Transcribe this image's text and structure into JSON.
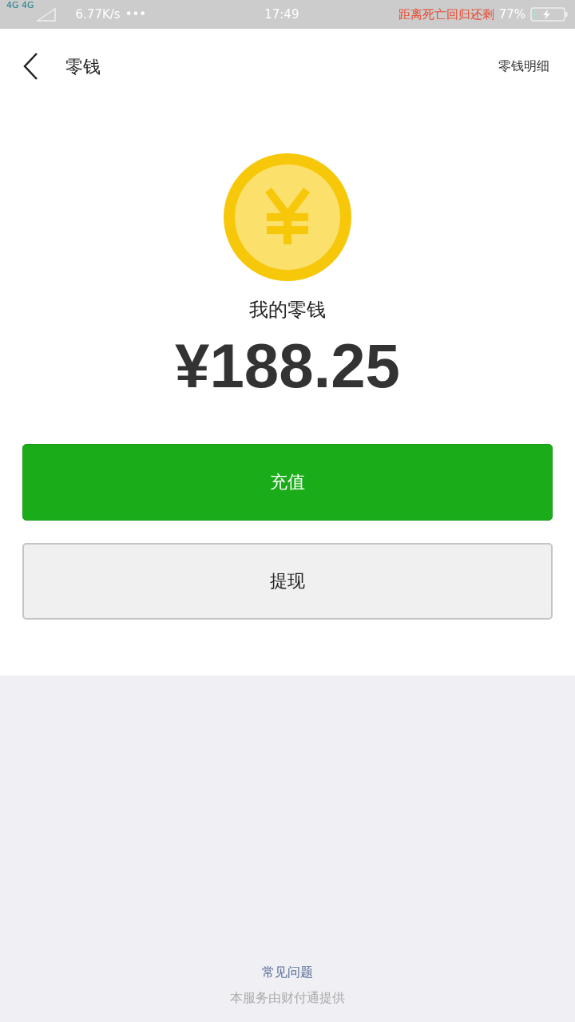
{
  "status_bar": {
    "network": "4G 4G",
    "speed": "6.77K/s",
    "dots": "•••",
    "time": "17:49",
    "notice": "距离死亡回归还剩",
    "battery": "77%"
  },
  "header": {
    "title": "零钱",
    "action": "零钱明细"
  },
  "balance": {
    "label": "我的零钱",
    "amount": "¥188.25"
  },
  "buttons": [
    {
      "label": "充值",
      "kind": "primary"
    },
    {
      "label": "提现",
      "kind": "secondary"
    }
  ],
  "footer": {
    "link": "常见问题",
    "note": "本服务由财付通提供"
  }
}
